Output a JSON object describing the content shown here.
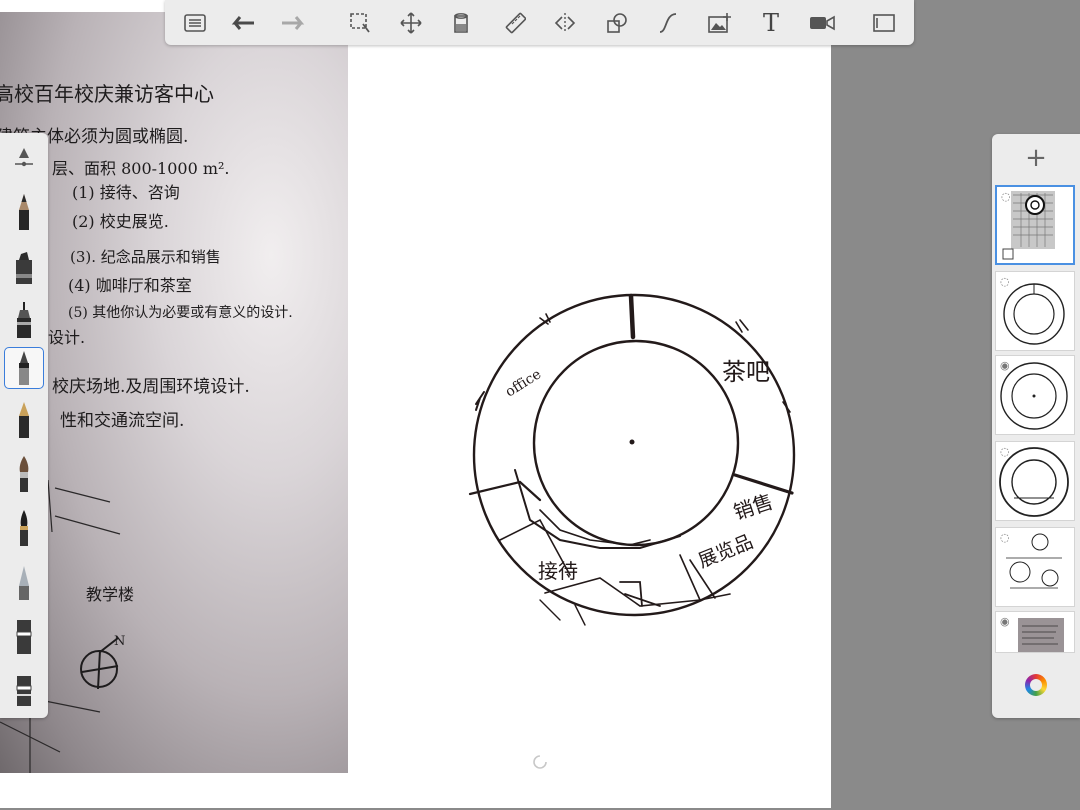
{
  "toolbar": {
    "tools": [
      {
        "name": "list-icon"
      },
      {
        "name": "undo-icon"
      },
      {
        "name": "redo-icon"
      },
      {
        "name": "selection-icon"
      },
      {
        "name": "move-icon"
      },
      {
        "name": "fill-bucket-icon"
      },
      {
        "name": "ruler-icon"
      },
      {
        "name": "symmetry-icon"
      },
      {
        "name": "shapes-icon"
      },
      {
        "name": "curve-icon"
      },
      {
        "name": "image-insert-icon"
      },
      {
        "name": "text-icon"
      },
      {
        "name": "video-icon"
      },
      {
        "name": "fullscreen-icon"
      }
    ],
    "text_tool_label": "T"
  },
  "brushes": {
    "selected_index": 4,
    "items": [
      "brush-settings-icon",
      "pencil-icon",
      "marker-icon",
      "fineliner-icon",
      "technical-pen-icon",
      "pen-icon",
      "paintbrush-icon",
      "brush-pen-icon",
      "airbrush-icon",
      "eraser-icon",
      "smudge-icon"
    ]
  },
  "layers": {
    "add_label": "+",
    "thumbnails": [
      {
        "label": "",
        "active": true
      },
      {
        "label": "",
        "active": false
      },
      {
        "label": "",
        "active": false
      },
      {
        "label": "",
        "active": false
      },
      {
        "label": "",
        "active": false
      },
      {
        "label": "",
        "active": false
      }
    ],
    "color_wheel_icon": "color-wheel-icon"
  },
  "photo_notes": {
    "line1": "高校百年校庆兼访客中心",
    "line2": "建筑主体必须为圆或椭圆.",
    "line3": "层、面积 800-1000 m².",
    "item1": "(1) 接待、咨询",
    "item2": "(2) 校史展览.",
    "item3": "(3). 纪念品展示和销售",
    "item4": "(4) 咖啡厅和茶室",
    "item5": "(5) 其他你认为必要或有意义的设计.",
    "line_design": "设计.",
    "site_line": "校庆场地.及周围环境设计.",
    "space_line": "性和交通流空间.",
    "label_building": "教学楼",
    "north": "N"
  },
  "sketch": {
    "label_office": "office",
    "label_teabar": "茶吧",
    "label_sales": "销售",
    "label_exhibit": "展览品",
    "label_reception": "接待"
  }
}
